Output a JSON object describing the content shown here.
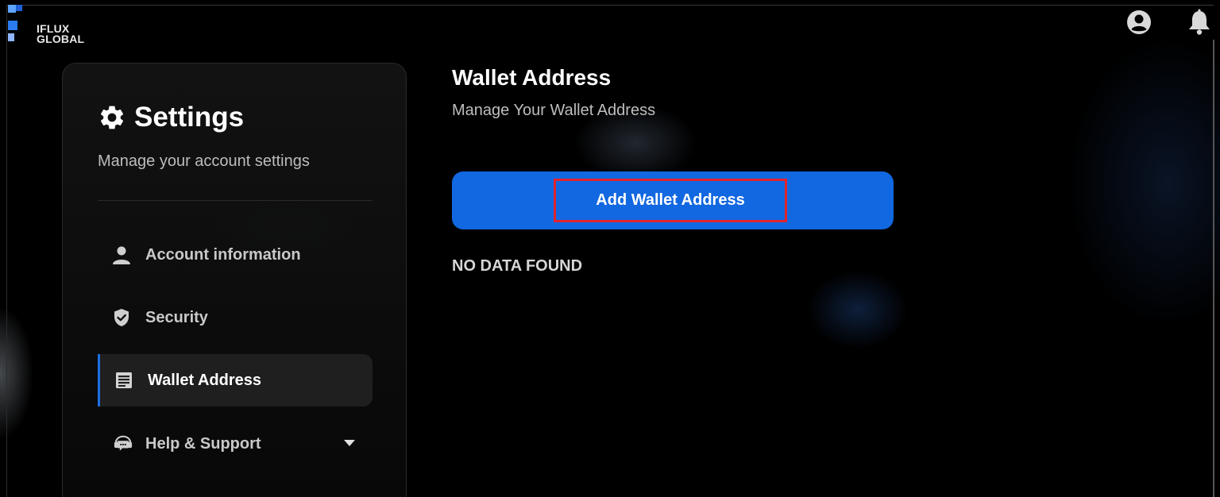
{
  "brand": {
    "line1": "IFLUX",
    "line2": "GLOBAL",
    "accent": "#2a7bf0"
  },
  "header": {
    "profile_icon": "account-circle-icon",
    "notifications_icon": "bell-icon"
  },
  "sidebar": {
    "title": "Settings",
    "title_icon": "gear-icon",
    "subtitle": "Manage your account settings",
    "items": [
      {
        "label": "Account information",
        "icon": "person-icon",
        "active": false
      },
      {
        "label": "Security",
        "icon": "shield-icon",
        "active": false
      },
      {
        "label": "Wallet Address",
        "icon": "wallet-list-icon",
        "active": true
      },
      {
        "label": "Help & Support",
        "icon": "support-chat-icon",
        "active": false,
        "expandable": true
      }
    ]
  },
  "main": {
    "title": "Wallet Address",
    "subtitle": "Manage Your Wallet Address",
    "add_button_label": "Add Wallet Address",
    "empty_text": "NO DATA FOUND"
  },
  "colors": {
    "primary_button": "#1268e0",
    "active_indicator": "#1d6fe0",
    "highlight_box": "#e2242e",
    "background": "#000000"
  }
}
